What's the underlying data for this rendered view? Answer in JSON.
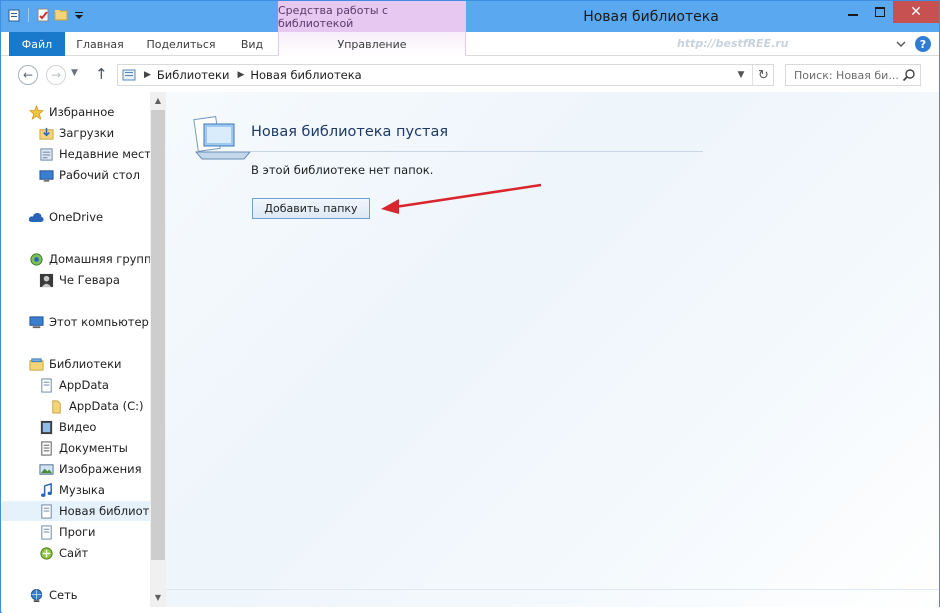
{
  "window": {
    "title": "Новая библиотека",
    "contextual_tab_group": "Средства работы с библиотекой",
    "close_label": "✕"
  },
  "ribbon": {
    "tabs": [
      {
        "label": "Файл"
      },
      {
        "label": "Главная"
      },
      {
        "label": "Поделиться"
      },
      {
        "label": "Вид"
      },
      {
        "label": "Управление"
      }
    ],
    "watermark": "http://bestfREE.ru",
    "help_label": "?"
  },
  "address_bar": {
    "breadcrumb": [
      "Библиотеки",
      "Новая библиотека"
    ],
    "search_placeholder": "Поиск: Новая би..."
  },
  "nav_pane": {
    "items": [
      {
        "label": "Избранное",
        "icon": "star-icon"
      },
      {
        "label": "Загрузки",
        "icon": "downloads-icon"
      },
      {
        "label": "Недавние места",
        "icon": "recent-places-icon"
      },
      {
        "label": "Рабочий стол",
        "icon": "desktop-icon"
      },
      {
        "label": "OneDrive",
        "icon": "cloud-icon"
      },
      {
        "label": "Домашняя группа",
        "icon": "homegroup-icon"
      },
      {
        "label": "Че Гевара",
        "icon": "user-icon"
      },
      {
        "label": "Этот компьютер",
        "icon": "computer-icon"
      },
      {
        "label": "Библиотеки",
        "icon": "libraries-icon"
      },
      {
        "label": "AppData",
        "icon": "library-icon"
      },
      {
        "label": "AppData (C:)",
        "icon": "folder-icon"
      },
      {
        "label": "Видео",
        "icon": "video-icon"
      },
      {
        "label": "Документы",
        "icon": "documents-icon"
      },
      {
        "label": "Изображения",
        "icon": "pictures-icon"
      },
      {
        "label": "Музыка",
        "icon": "music-icon"
      },
      {
        "label": "Новая библиотека",
        "icon": "library-icon",
        "selected": true
      },
      {
        "label": "Проги",
        "icon": "library-icon"
      },
      {
        "label": "Сайт",
        "icon": "site-icon"
      },
      {
        "label": "Сеть",
        "icon": "network-icon"
      }
    ]
  },
  "content": {
    "empty_title": "Новая библиотека пустая",
    "empty_description": "В этой библиотеке нет папок.",
    "add_folder_button": "Добавить папку"
  },
  "colors": {
    "titlebar": "#5aa8f0",
    "file_tab": "#1979ca",
    "contextual_tab": "#e6c8f0",
    "close_button": "#c75050",
    "annotation_arrow": "#d9262c"
  }
}
